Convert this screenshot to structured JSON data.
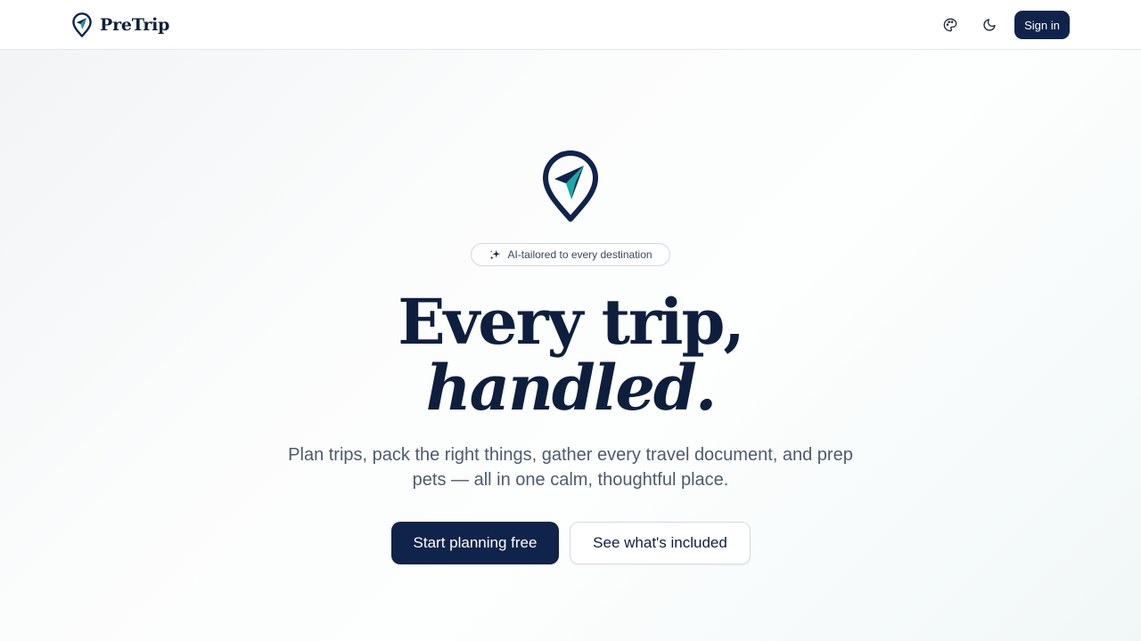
{
  "header": {
    "brand_name": "PreTrip",
    "brand_logo_icon": "map-pin-paper-plane-icon",
    "theme_icon": "palette-icon",
    "dark_mode_icon": "moon-icon",
    "signin_label": "Sign in"
  },
  "hero": {
    "logo_icon": "map-pin-paper-plane-icon",
    "badge_icon": "sparkles-icon",
    "badge_text": "AI-tailored to every destination",
    "headline_line1": "Every trip,",
    "headline_line2": "handled.",
    "subtitle": "Plan trips, pack the right things, gather every travel document, and prep pets — all in one calm, thoughtful place.",
    "primary_cta": "Start planning free",
    "secondary_cta": "See what's included"
  },
  "colors": {
    "navy": "#10234a",
    "teal": "#1aa9a6",
    "text_muted": "#4e5b6d"
  }
}
